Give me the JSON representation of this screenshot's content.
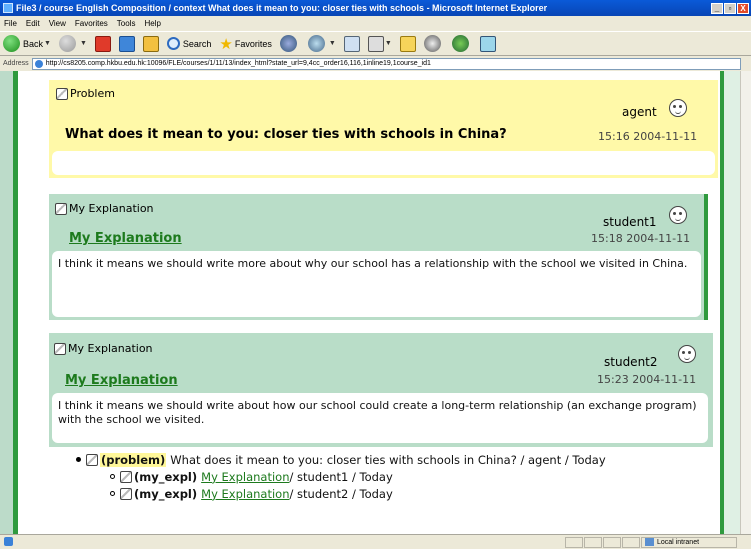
{
  "window": {
    "title": "File3 / course English Composition / context What does it mean to you: closer ties with schools - Microsoft Internet Explorer",
    "minimize": "_",
    "restore": "▫",
    "close": "X"
  },
  "menu": [
    "File",
    "Edit",
    "View",
    "Favorites",
    "Tools",
    "Help"
  ],
  "toolbar": {
    "back": "Back",
    "search": "Search",
    "favorites": "Favorites"
  },
  "address": {
    "label": "Address",
    "url": "http://cs8205.comp.hkbu.edu.hk:10096/FLE/courses/1/11/13/index_html?state_url=9,4cc_order16,116,1inline19,1course_id1"
  },
  "notes": [
    {
      "type_label": "Problem",
      "author": "agent",
      "title": "What does it mean to you: closer ties with schools in China?",
      "time": "15:16 2004-11-11",
      "body": ""
    },
    {
      "type_label": "My Explanation",
      "author": "student1",
      "title": "My Explanation",
      "time": "15:18 2004-11-11",
      "body": "I think it means we should write more about why our school has a relationship with the school we visited in China."
    },
    {
      "type_label": "My Explanation",
      "author": "student2",
      "title": "My Explanation",
      "time": "15:23 2004-11-11",
      "body": "I think it means we should write about how our school could create a long-term relationship (an exchange program) with the school we visited."
    }
  ],
  "thread": {
    "root": {
      "tag": "(problem)",
      "text": "What does it mean to you: closer ties with schools in China? / agent / Today"
    },
    "children": [
      {
        "tag": "(my_expl)",
        "link": "My Explanation",
        "meta": " / student1 / Today"
      },
      {
        "tag": "(my_expl)",
        "link": "My Explanation",
        "meta": " / student2 / Today"
      }
    ]
  },
  "status": {
    "zone": "Local intranet"
  },
  "colors": {
    "problem_bg": "#fff9a8",
    "explanation_bg": "#b9ddc8",
    "accent_green": "#2f9a3e",
    "link_green": "#1d7a1d"
  },
  "icons": {
    "note_type": "note-type-icon",
    "author": "smiley-face-icon"
  }
}
